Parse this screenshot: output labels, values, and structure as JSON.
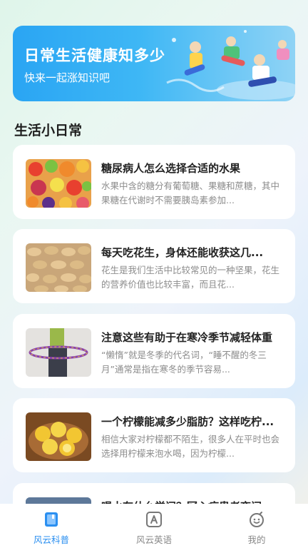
{
  "banner": {
    "title": "日常生活健康知多少",
    "subtitle": "快来一起涨知识吧"
  },
  "section": {
    "title": "生活小日常"
  },
  "articles": [
    {
      "title": "糖尿病人怎么选择合适的水果",
      "desc": "水果中含的糖分有葡萄糖、果糖和蔗糖，其中果糖在代谢时不需要胰岛素参加...",
      "image": "fruit-image"
    },
    {
      "title": "每天吃花生，身体还能收获这几...",
      "desc": "花生是我们生活中比较常见的一种坚果，花生的营养价值也比较丰富，而且花...",
      "image": "peanut-image"
    },
    {
      "title": "注意这些有助于在寒冷季节减轻体重",
      "desc": "“懒惰”就是冬季的代名词，“睡不醒的冬三月”通常是指在寒冬的季节容易...",
      "image": "hula-hoop-image"
    },
    {
      "title": "一个柠檬能减多少脂肪？这样吃柠...",
      "desc": "相信大家对柠檬都不陌生，很多人在平时也会选择用柠檬来泡水喝，因为柠檬...",
      "image": "lemon-image"
    },
    {
      "title": "喝水有什么学问？冠心病患者夜间...",
      "desc": "",
      "image": "water-image"
    }
  ],
  "tabs": [
    {
      "label": "风云科普",
      "icon": "book-icon",
      "active": true
    },
    {
      "label": "风云英语",
      "icon": "letter-a-icon",
      "active": false
    },
    {
      "label": "我的",
      "icon": "smiley-icon",
      "active": false
    }
  ],
  "colors": {
    "accent": "#2b8ff0",
    "banner_start": "#2aa5f3",
    "banner_end": "#8fd3f5",
    "card_bg": "#ffffff",
    "title_text": "#222222",
    "desc_text": "#8c8c8c"
  }
}
